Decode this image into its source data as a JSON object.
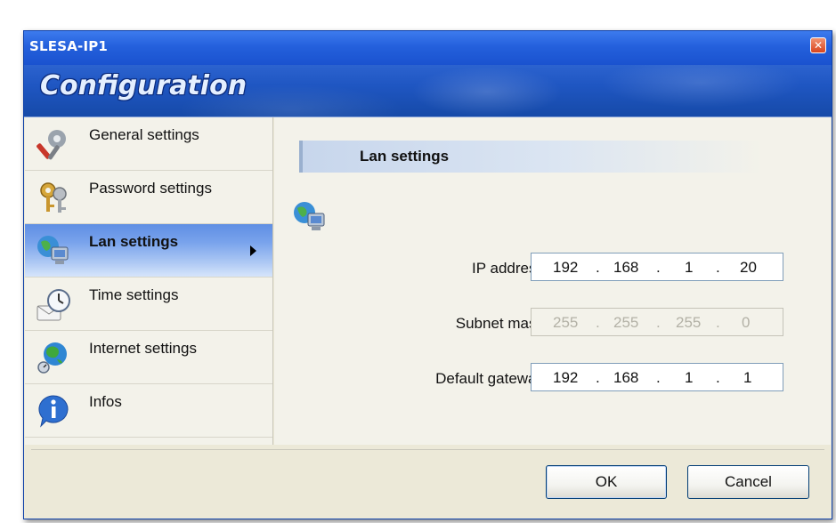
{
  "window": {
    "title": "SLESA-IP1",
    "close_glyph": "✕"
  },
  "banner": {
    "title": "Configuration"
  },
  "sidebar": {
    "items": [
      {
        "label": "General settings",
        "icon": "tools-icon",
        "active": false
      },
      {
        "label": "Password settings",
        "icon": "keys-icon",
        "active": false
      },
      {
        "label": "Lan settings",
        "icon": "network-globe-icon",
        "active": true
      },
      {
        "label": "Time settings",
        "icon": "clock-icon",
        "active": false
      },
      {
        "label": "Internet settings",
        "icon": "globe-icon",
        "active": false
      },
      {
        "label": "Infos",
        "icon": "info-icon",
        "active": false
      }
    ]
  },
  "section": {
    "title": "Lan settings",
    "icon": "network-globe-icon",
    "fields": {
      "ip_address": {
        "label": "IP address",
        "octets": [
          "192",
          "168",
          "1",
          "20"
        ],
        "enabled": true
      },
      "subnet_mask": {
        "label": "Subnet mask",
        "octets": [
          "255",
          "255",
          "255",
          "0"
        ],
        "enabled": false
      },
      "default_gateway": {
        "label": "Default gateway",
        "octets": [
          "192",
          "168",
          "1",
          "1"
        ],
        "enabled": true
      }
    },
    "separator": "."
  },
  "buttons": {
    "ok": "OK",
    "cancel": "Cancel"
  },
  "colors": {
    "titlebar": "#2460dc",
    "active_item": "#79a3ec",
    "window_bg": "#ece9d8"
  }
}
